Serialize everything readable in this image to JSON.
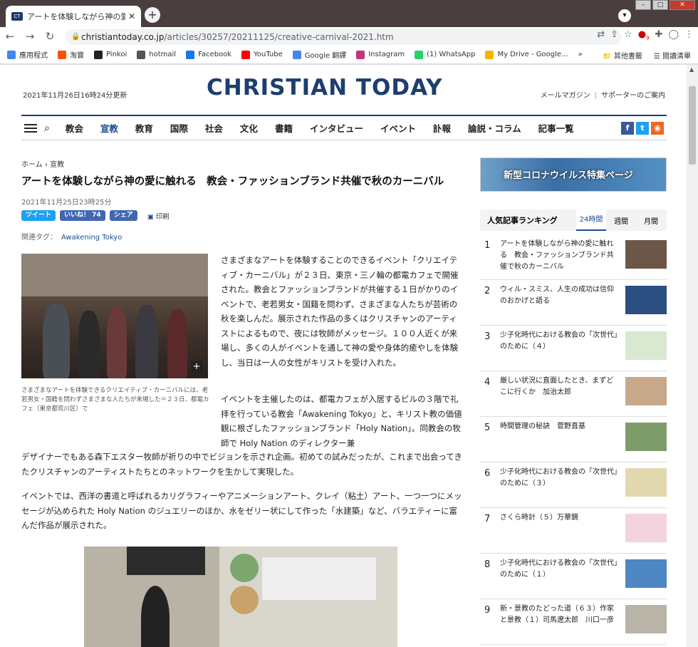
{
  "browser": {
    "tab_title": "アートを体験しながら神の愛に触",
    "tab_favicon": "CT",
    "url_domain": "christiantoday.co.jp",
    "url_path": "/articles/30257/20211125/creative-carnival-2021.htm",
    "extension_badge": "9"
  },
  "bookmarks": {
    "items": [
      {
        "label": "應用程式",
        "color": "#4285f4"
      },
      {
        "label": "淘寶",
        "color": "#ff5000"
      },
      {
        "label": "Pinkoi",
        "color": "#222222"
      },
      {
        "label": "hotmail",
        "color": "#555555"
      },
      {
        "label": "Facebook",
        "color": "#1877f2"
      },
      {
        "label": "YouTube",
        "color": "#ff0000"
      },
      {
        "label": "Google 翻譯",
        "color": "#4285f4"
      },
      {
        "label": "Instagram",
        "color": "#c13584"
      },
      {
        "label": "(1) WhatsApp",
        "color": "#25d366"
      },
      {
        "label": "My Drive - Google...",
        "color": "#f4b400"
      }
    ],
    "more": "»",
    "other": "其他書籤",
    "reading_list": "閱讀清單"
  },
  "header": {
    "updated": "2021年11月26日16時24分更新",
    "logo": "CHRISTIAN TODAY",
    "link_newsletter": "メールマガジン",
    "link_supporter": "サポーターのご案内"
  },
  "nav": {
    "items": [
      "教会",
      "宣教",
      "教育",
      "国際",
      "社会",
      "文化",
      "書籍",
      "インタビュー",
      "イベント",
      "訃報",
      "論説・コラム",
      "記事一覧"
    ],
    "active": "宣教"
  },
  "article": {
    "breadcrumb_home": "ホーム",
    "breadcrumb_sep": "›",
    "breadcrumb_section": "宣教",
    "title": "アートを体験しながら神の愛に触れる　教会・ファッションブランド共催で秋のカーニバル",
    "date": "2021年11月25日23時25分",
    "tweet": "ツイート",
    "like": "いいね！ 74",
    "share": "シェア",
    "print": "印刷",
    "tags_label": "関連タグ：",
    "tag": "Awakening Tokyo",
    "caption": "さまざまなアートを体験できるクリエイティブ・カーニバルには、老若男女・国籍を問わずさまざまな人たちが来場した＝２３日、都電カフェ（東京都荒川区）で",
    "para1": "さまざまなアートを体験することのできるイベント「クリエイティブ・カーニバル」が２３日、東京・三ノ輪の都電カフェで開催された。教会とファッションブランドが共催する１日がかりのイベントで、老若男女・国籍を問わず、さまざまな人たちが芸術の秋を楽しんだ。展示された作品の多くはクリスチャンのアーティストによるもので、夜には牧師がメッセージ。１００人近くが来場し、多くの人がイベントを通して神の愛や身体的癒やしを体験し、当日は一人の女性がキリストを受け入れた。",
    "para2a": "イベントを主催したのは、都電カフェが入居するビルの３階で礼拝を行っている教会「Awakening Tokyo」と、キリスト教の価値観に根ざしたファッションブランド「Holy Nation」。同教会の牧師で Holy Nation のディレクター兼",
    "para2b": "デザイナーでもある森下エスター牧師が祈りの中でビジョンを示され企画。初めての試みだったが、これまで出会ってきたクリスチャンのアーティストたちとのネットワークを生かして実現した。",
    "para3": "イベントでは、西洋の書道と呼ばれるカリグラフィーやアニメーションアート、クレイ（粘土）アート、一つ一つにメッセージが込められた Holy Nation のジュエリーのほか、水をゼリー状にして作った「水建築」など、バラエティーに富んだ作品が展示された。"
  },
  "sidebar": {
    "covid_banner": "新型コロナウイルス特集ページ",
    "ranking_title": "人気記事ランキング",
    "tabs": [
      "24時間",
      "週間",
      "月間"
    ],
    "ranking": [
      {
        "n": "1",
        "title": "アートを体験しながら神の愛に触れる　教会・ファッションブランド共催で秋のカーニバル",
        "thumb": "#6b5648"
      },
      {
        "n": "2",
        "title": "ウィル・スミス、人生の成功は信仰のおかげと語る",
        "thumb": "#2a4f80"
      },
      {
        "n": "3",
        "title": "少子化時代における教会の「次世代」のために（４）",
        "thumb": "#d9e8d0"
      },
      {
        "n": "4",
        "title": "厳しい状況に直面したとき、まずどこに行くか　加治太郎",
        "thumb": "#c7a88a"
      },
      {
        "n": "5",
        "title": "時間管理の秘訣　菅野直基",
        "thumb": "#7f9c6b"
      },
      {
        "n": "6",
        "title": "少子化時代における教会の「次世代」のために（３）",
        "thumb": "#e2d8b0"
      },
      {
        "n": "7",
        "title": "さくら時計（５）万華鏡",
        "thumb": "#f3d4dc"
      },
      {
        "n": "8",
        "title": "少子化時代における教会の「次世代」のために（１）",
        "thumb": "#4f86c4"
      },
      {
        "n": "9",
        "title": "新・景教のたどった道（６３）作家と景教（１）司馬遼太郎　川口一彦",
        "thumb": "#b8b4a8"
      }
    ]
  }
}
